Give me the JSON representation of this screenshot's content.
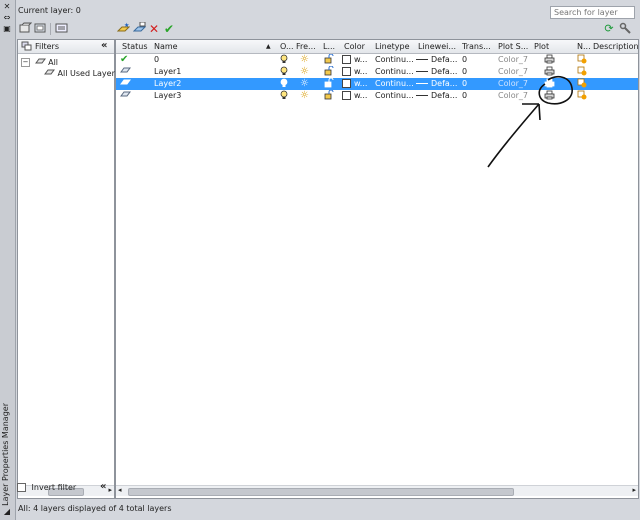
{
  "palette": {
    "selection": "#3399ff",
    "check_green": "#2aa52a",
    "delete_red": "#d32020",
    "refresh_green": "#1e9a3a"
  },
  "side_title": "Layer Properties Manager",
  "current_layer": "Current layer: 0",
  "search": {
    "placeholder": "Search for layer"
  },
  "toolbar": {
    "left_icons": [
      "new-property-filter-icon",
      "new-group-filter-icon",
      "layer-states-manager-icon"
    ],
    "right_icons": [
      "new-layer-icon",
      "new-layer-vp-frozen-icon",
      "delete-layer-icon",
      "set-current-icon"
    ],
    "far_right_icons": [
      "refresh-icon",
      "settings-icon"
    ]
  },
  "filters": {
    "header": "Filters",
    "tree": [
      {
        "label": "All"
      },
      {
        "label": "All Used Layers"
      }
    ],
    "invert_filter_label": "Invert filter"
  },
  "columns": [
    "Status",
    "Name",
    "O...",
    "Fre...",
    "L...",
    "Color",
    "Linetype",
    "Linewei...",
    "Trans...",
    "Plot S...",
    "Plot",
    "N...",
    "Description"
  ],
  "layers": [
    {
      "name": "0",
      "color": "w...",
      "linetype": "Continu...",
      "lineweight": "Defa...",
      "transparency": "0",
      "plot_style": "Color_7",
      "current": true,
      "selected": false
    },
    {
      "name": "Layer1",
      "color": "w...",
      "linetype": "Continu...",
      "lineweight": "Defa...",
      "transparency": "0",
      "plot_style": "Color_7",
      "current": false,
      "selected": false
    },
    {
      "name": "Layer2",
      "color": "w...",
      "linetype": "Continu...",
      "lineweight": "Defa...",
      "transparency": "0",
      "plot_style": "Color_7",
      "current": false,
      "selected": true
    },
    {
      "name": "Layer3",
      "color": "w...",
      "linetype": "Continu...",
      "lineweight": "Defa...",
      "transparency": "0",
      "plot_style": "Color_7",
      "current": false,
      "selected": false
    }
  ],
  "status_text": "All: 4 layers displayed of 4 total layers"
}
